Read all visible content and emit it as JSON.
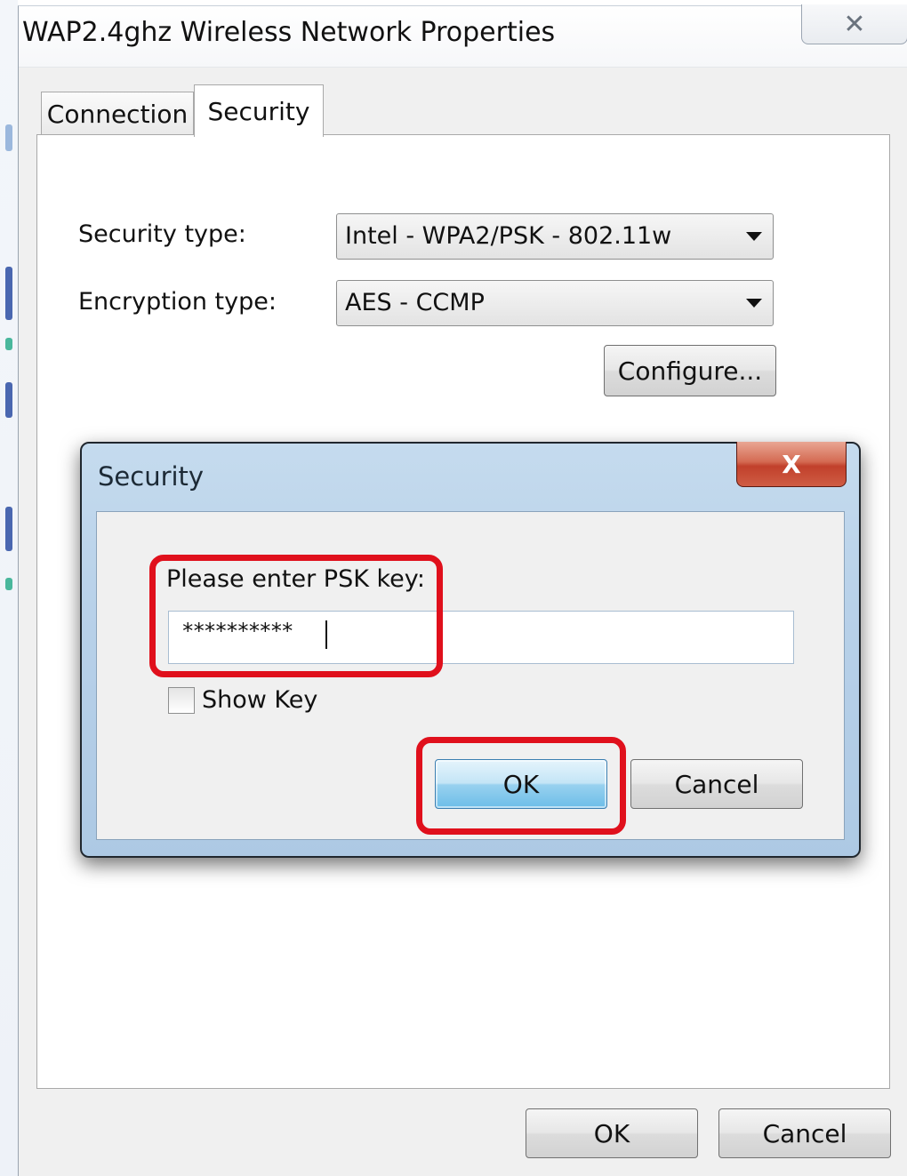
{
  "window": {
    "title": "WAP2.4ghz Wireless Network Properties",
    "close_glyph": "✕"
  },
  "tabs": [
    {
      "label": "Connection",
      "selected": false
    },
    {
      "label": "Security",
      "selected": true
    }
  ],
  "security_tab": {
    "security_type_label": "Security type:",
    "security_type_value": "Intel - WPA2/PSK - 802.11w",
    "encryption_type_label": "Encryption type:",
    "encryption_type_value": "AES - CCMP",
    "configure_label": "Configure..."
  },
  "security_dialog": {
    "title": "Security",
    "close_glyph": "X",
    "psk_label": "Please enter PSK key:",
    "psk_value": "**********",
    "show_key_label": "Show Key",
    "show_key_checked": false,
    "ok_label": "OK",
    "cancel_label": "Cancel"
  },
  "footer": {
    "ok_label": "OK",
    "cancel_label": "Cancel"
  },
  "colors": {
    "highlight": "#e0101c",
    "dialog_titlebar": "#b8d1e9",
    "close_button": "#c1402b",
    "default_button": "#98d1ef"
  },
  "icons": [
    "close-icon",
    "dropdown-arrow-icon",
    "checkbox-icon"
  ]
}
